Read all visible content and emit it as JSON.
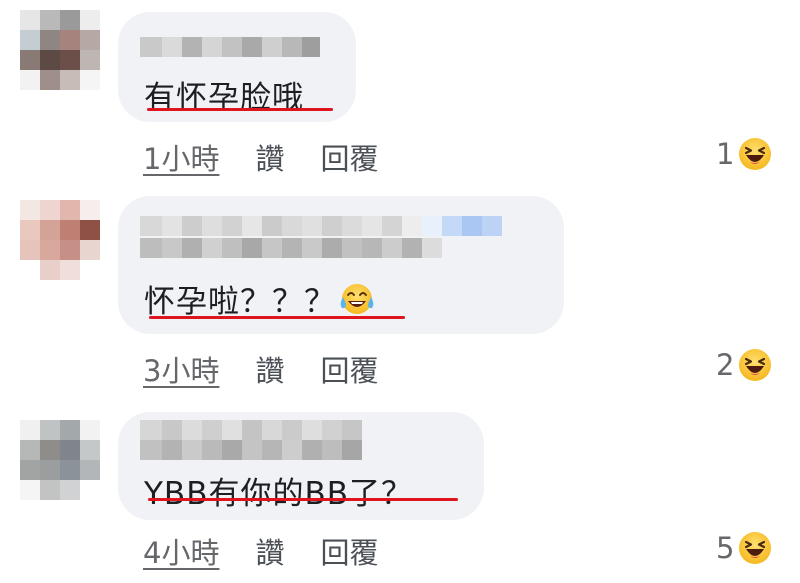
{
  "comments": [
    {
      "text": "有怀孕脸哦",
      "time": "1小時",
      "like": "讚",
      "reply": "回覆",
      "reaction_count": "1",
      "reaction_icon": "laughing-face-icon"
    },
    {
      "text": "怀孕啦？？？",
      "inline_emoji": "tears-of-joy-icon",
      "time": "3小時",
      "like": "讚",
      "reply": "回覆",
      "reaction_count": "2",
      "reaction_icon": "laughing-face-icon"
    },
    {
      "text": "YBB有你的BB了？",
      "time": "4小時",
      "like": "讚",
      "reply": "回覆",
      "reaction_count": "5",
      "reaction_icon": "laughing-face-icon"
    }
  ],
  "colors": {
    "bubble": "#f0f2f5",
    "underline": "#e0141e",
    "meta_text": "#65676b",
    "emoji_yellow": "#ffcc33"
  }
}
